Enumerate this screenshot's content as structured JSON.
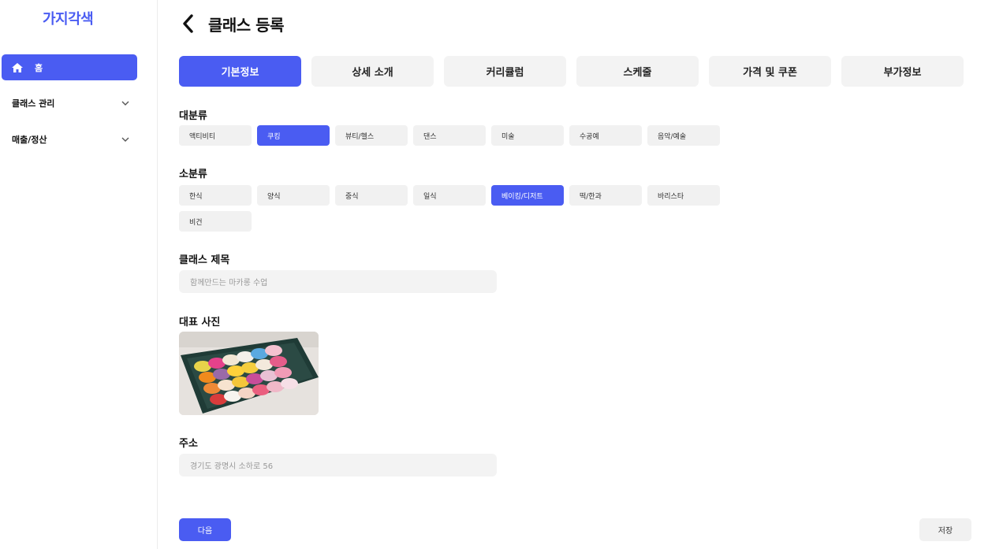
{
  "app": {
    "logo": "가지각색"
  },
  "sidebar": {
    "home_label": "홈",
    "groups": [
      {
        "label": "클래스 관리"
      },
      {
        "label": "매출/정산"
      }
    ]
  },
  "header": {
    "title": "클래스 등록"
  },
  "tabs": [
    {
      "label": "기본정보",
      "active": true
    },
    {
      "label": "상세 소개"
    },
    {
      "label": "커리큘럼"
    },
    {
      "label": "스케줄"
    },
    {
      "label": "가격 및 쿠폰"
    },
    {
      "label": "부가정보"
    }
  ],
  "category_main": {
    "label": "대분류",
    "items": [
      "액티비티",
      "쿠킹",
      "뷰티/헬스",
      "댄스",
      "미술",
      "수공예",
      "음악/예술"
    ],
    "selected": "쿠킹"
  },
  "category_sub": {
    "label": "소분류",
    "items": [
      "한식",
      "양식",
      "중식",
      "일식",
      "베이킹/디저트",
      "떡/한과",
      "바리스타",
      "비건"
    ],
    "selected": "베이킹/디저트"
  },
  "class_title": {
    "label": "클래스 제목",
    "placeholder": "함께만드는 마카롱 수업"
  },
  "photo": {
    "label": "대표 사진"
  },
  "address": {
    "label": "주소",
    "placeholder": "경기도 광명시 소하로 56"
  },
  "actions": {
    "next_label": "다음",
    "save_label": "저장"
  },
  "colors": {
    "accent": "#4a5cf2",
    "chip_bg": "#f1f1f1"
  }
}
